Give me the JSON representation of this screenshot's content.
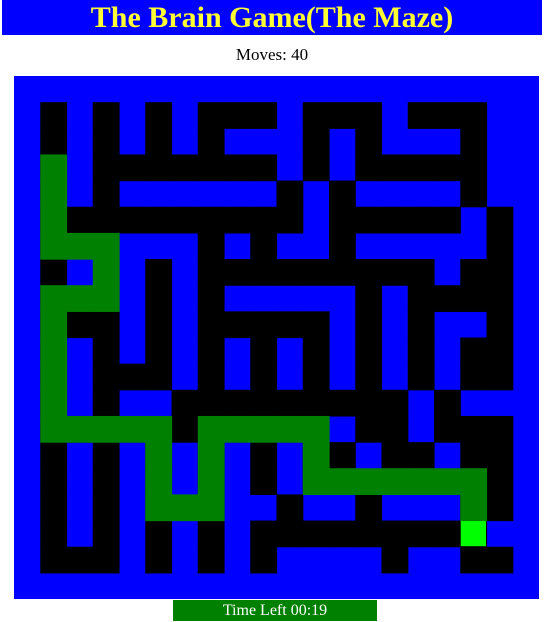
{
  "header": {
    "title": "The Brain Game(The Maze)"
  },
  "status": {
    "moves_label": "Moves: 40",
    "time_label": "Time Left 00:19"
  },
  "colors": {
    "board": "#0000ff",
    "corridor": "#000000",
    "trail": "#008000",
    "player": "#00ff00",
    "title_text": "#ffff33",
    "timer_bg": "#008000"
  },
  "maze": {
    "rows": 20,
    "cols": 20,
    "corridor_rows": [
      "BBBBBBBBBBBBBBBBBBBB",
      "B.B.B.B...B...B...BB",
      "B.B.B.B.BBB.B.BBB.BB",
      "B.B.......B.B.....BB",
      "B.B.BBBBBB.B.BBBB.BB",
      "B..........B.....B.B",
      "B.BBBBB.B.BB.BBBBB.B",
      "B.BBB.B.........B..B",
      "B.BBB.B.BBBBB.B....B",
      "B...B.B.....B.B.BB.B",
      "B.B.B.B.B.B.B.B.B..B",
      "B.B...B.B.B.B.B.B..B",
      "B.B.BB.........B.BBB",
      "B...BB.BBBBBB..B...B",
      "B.B.B.B.B.B..B..B..B",
      "B.B.B.B.B.B..B.BB..B",
      "B.B.B.B.BB.BB.BBB..B",
      "B.B.B.B.B.........BB",
      "B...B.B.B.BBBB.BB..B",
      "BBBBBBBBBBBBBBBBBBBB"
    ],
    "trail": [
      [
        3,
        1
      ],
      [
        4,
        1
      ],
      [
        5,
        1
      ],
      [
        6,
        1
      ],
      [
        6,
        2
      ],
      [
        6,
        3
      ],
      [
        7,
        3
      ],
      [
        8,
        3
      ],
      [
        8,
        2
      ],
      [
        8,
        1
      ],
      [
        9,
        1
      ],
      [
        10,
        1
      ],
      [
        11,
        1
      ],
      [
        12,
        1
      ],
      [
        13,
        1
      ],
      [
        13,
        2
      ],
      [
        13,
        3
      ],
      [
        13,
        4
      ],
      [
        13,
        5
      ],
      [
        14,
        5
      ],
      [
        15,
        5
      ],
      [
        16,
        5
      ],
      [
        16,
        6
      ],
      [
        16,
        7
      ],
      [
        15,
        7
      ],
      [
        14,
        7
      ],
      [
        13,
        7
      ],
      [
        13,
        8
      ],
      [
        13,
        9
      ],
      [
        13,
        10
      ],
      [
        13,
        11
      ],
      [
        14,
        11
      ],
      [
        15,
        11
      ],
      [
        15,
        12
      ],
      [
        15,
        13
      ],
      [
        15,
        14
      ],
      [
        15,
        15
      ],
      [
        15,
        16
      ],
      [
        15,
        17
      ],
      [
        16,
        17
      ]
    ],
    "player": [
      17,
      17
    ]
  }
}
